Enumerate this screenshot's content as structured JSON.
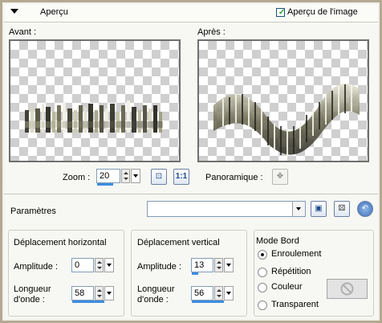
{
  "header": {
    "title": "Aperçu",
    "preview_checkbox_label": "Aperçu de l'image",
    "preview_checked": true
  },
  "preview": {
    "before_label": "Avant :",
    "after_label": "Après :"
  },
  "zoom": {
    "label": "Zoom :",
    "value": "20"
  },
  "pan": {
    "label": "Panoramique :"
  },
  "buttons": {
    "fit_label": "1:1"
  },
  "presets": {
    "label": "Paramètres",
    "value": ""
  },
  "horizontal": {
    "title": "Déplacement horizontal",
    "amplitude_label": "Amplitude :",
    "amplitude_value": "0",
    "wavelength_label_1": "Longueur",
    "wavelength_label_2": "d'onde :",
    "wavelength_value": "58"
  },
  "vertical": {
    "title": "Déplacement vertical",
    "amplitude_label": "Amplitude :",
    "amplitude_value": "13",
    "wavelength_label_1": "Longueur",
    "wavelength_label_2": "d'onde :",
    "wavelength_value": "56"
  },
  "edge_mode": {
    "title": "Mode Bord",
    "options": [
      "Enroulement",
      "Répétition",
      "Couleur",
      "Transparent"
    ],
    "selected": "Enroulement"
  },
  "colors": {
    "accent": "#3c8de0",
    "frame": "#b3a990"
  }
}
